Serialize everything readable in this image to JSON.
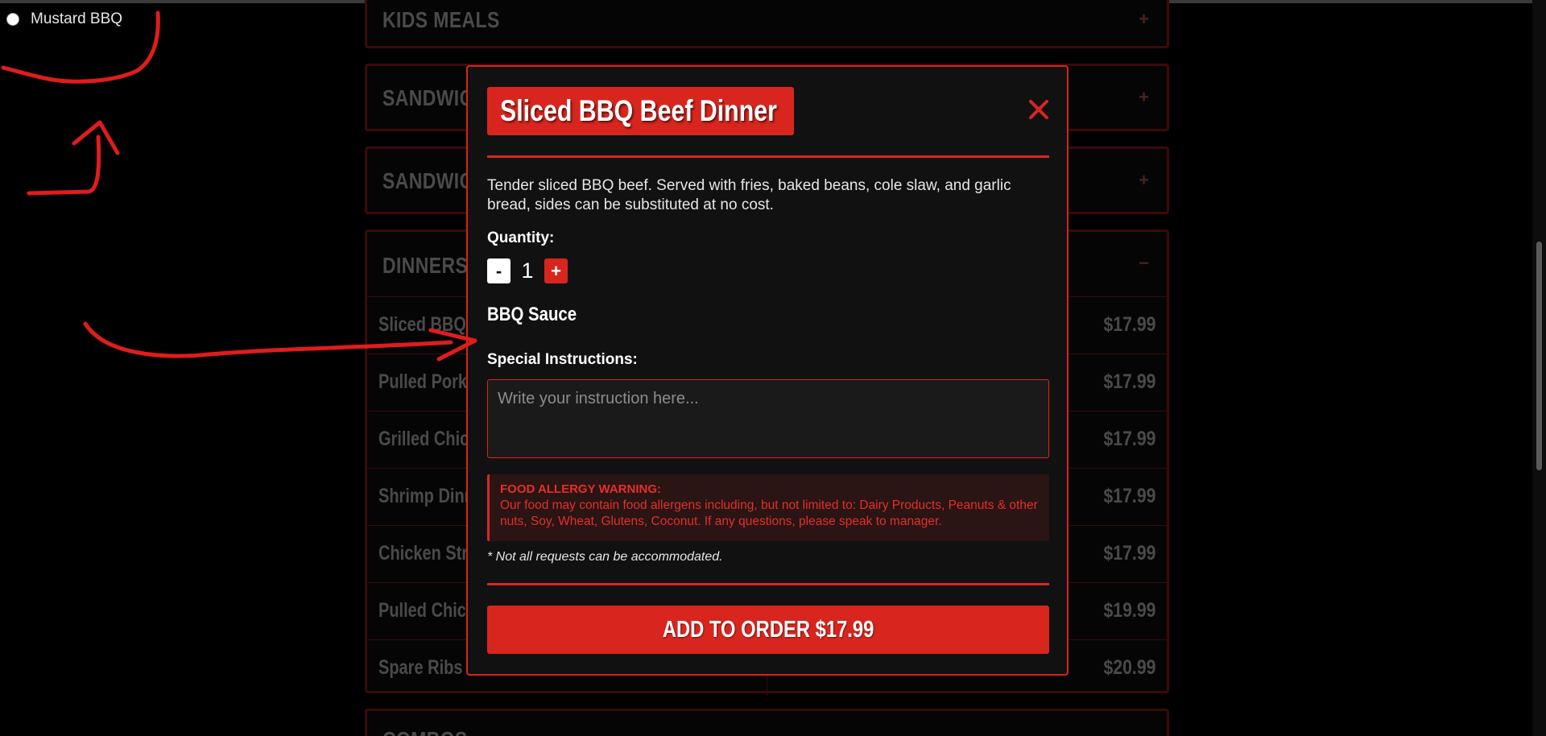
{
  "radio_label": "Mustard BBQ",
  "menu": {
    "categories": [
      {
        "title": "KIDS MEALS",
        "sign": "+"
      },
      {
        "title": "SANDWICHES",
        "sign": "+"
      },
      {
        "title": "SANDWICHES",
        "sign": "+"
      },
      {
        "title": "DINNERS",
        "sign": "−"
      },
      {
        "title": "COMBOS",
        "sign": "+"
      }
    ],
    "dinners": [
      {
        "name": "Sliced BBQ Beef Dinner",
        "price": "$17.99"
      },
      {
        "name": "Pulled Pork Dinner",
        "price": "$17.99"
      },
      {
        "name": "Grilled Chicken Dinner",
        "price": "$17.99"
      },
      {
        "name": "Shrimp Dinner",
        "price": "$17.99"
      },
      {
        "name": "Chicken Strips Dinner",
        "price": "$17.99"
      },
      {
        "name": "Pulled Chicken Dinner",
        "price": "$19.99"
      },
      {
        "name": "Spare Ribs",
        "price": "$20.99"
      }
    ]
  },
  "modal": {
    "title": "Sliced BBQ Beef Dinner",
    "description": "Tender sliced BBQ beef. Served with fries, baked beans, cole slaw, and garlic bread, sides can be substituted at no cost.",
    "quantity_label": "Quantity:",
    "quantity_minus": "-",
    "quantity_value": "1",
    "quantity_plus": "+",
    "section_heading": "BBQ Sauce",
    "instructions_label": "Special Instructions:",
    "instructions_placeholder": "Write your instruction here...",
    "warning_title": "FOOD ALLERGY WARNING:",
    "warning_text": "Our food may contain food allergens including, but not limited to: Dairy Products, Peanuts & other nuts, Soy, Wheat, Glutens, Coconut. If any questions, please speak to manager.",
    "note": "* Not all requests can be accommodated.",
    "add_button": "ADD TO ORDER $17.99"
  },
  "colors": {
    "accent": "#d8261f",
    "background": "#000000",
    "modal_bg": "#111112",
    "annotation": "#e01c1c"
  },
  "icons": {
    "close": "close-icon",
    "radio": "radio-icon"
  }
}
